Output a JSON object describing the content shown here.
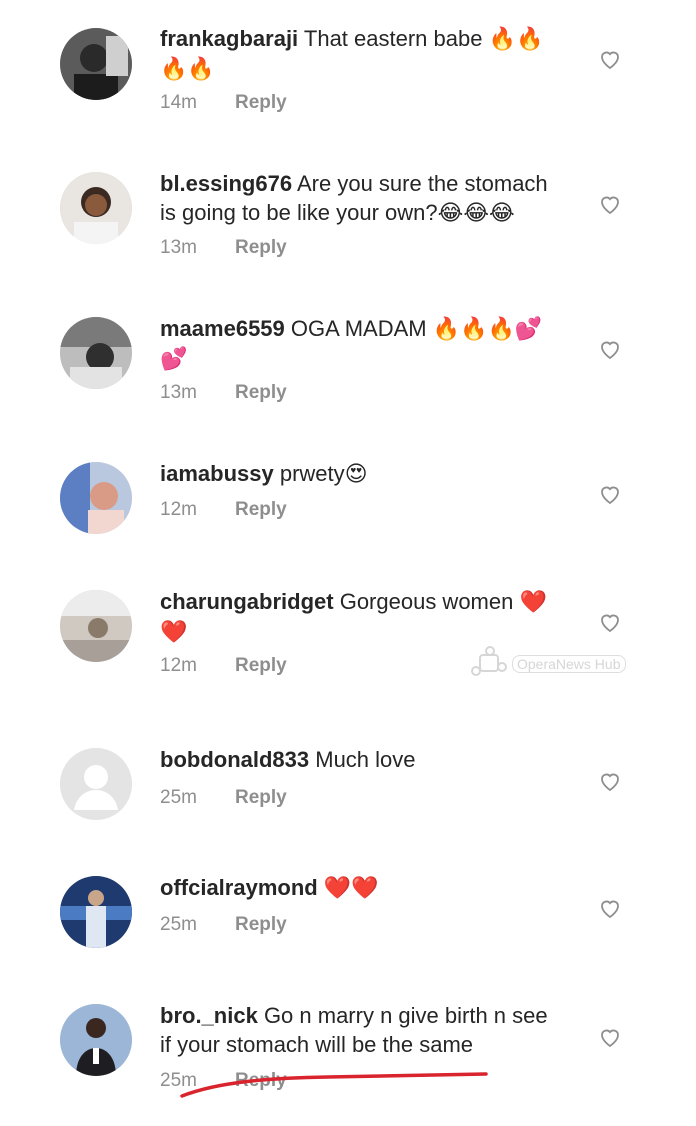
{
  "comments": [
    {
      "username": "frankagbaraji",
      "text": "That eastern babe",
      "emoji_line1": "🔥🔥",
      "emoji_line2": "🔥🔥",
      "time": "14m",
      "reply": "Reply"
    },
    {
      "username": "bl.essing676",
      "text": "Are you sure the stomach",
      "text_line2": "is going to be like your own?",
      "emoji_line2": "😂😂😂",
      "time": "13m",
      "reply": "Reply"
    },
    {
      "username": "maame6559",
      "text": "OGA MADAM",
      "emoji_line1": "🔥🔥🔥💕",
      "emoji_line2": "💕",
      "time": "13m",
      "reply": "Reply"
    },
    {
      "username": "iamabussy",
      "text": "prwety",
      "emoji_line1": "😍",
      "time": "12m",
      "reply": "Reply"
    },
    {
      "username": "charungabridget",
      "text": "Gorgeous women",
      "emoji_line1": "❤️",
      "emoji_line2": "❤️",
      "time": "12m",
      "reply": "Reply"
    },
    {
      "username": "bobdonald833",
      "text": "Much love",
      "time": "25m",
      "reply": "Reply"
    },
    {
      "username": "offcialraymond",
      "text": "",
      "emoji_line1": "❤️❤️",
      "time": "25m",
      "reply": "Reply"
    },
    {
      "username": "bro._nick",
      "text": "Go n marry n give birth n see",
      "text_line2": "if your stomach will be the same",
      "time": "25m",
      "reply": "Reply"
    }
  ],
  "watermark": {
    "text": "OperaNews Hub"
  },
  "colors": {
    "username": "#262626",
    "meta": "#8e8e8e",
    "heart_outline": "#8e8e8e",
    "annotation_underline": "#d9232d"
  }
}
